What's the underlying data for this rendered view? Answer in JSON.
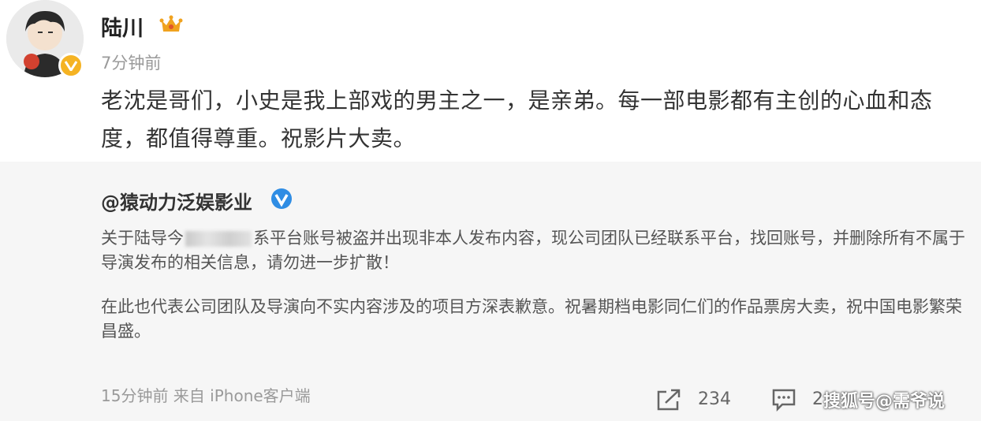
{
  "post": {
    "username": "陆川",
    "time": "7分钟前",
    "text": "老沈是哥们，小史是我上部戏的男主之一，是亲弟。每一部电影都有主创的心血和态度，都值得尊重。祝影片大卖。"
  },
  "repost": {
    "author": "@猿动力泛娱影业",
    "paragraph1_before": "关于陆导今",
    "paragraph1_after": "系平台账号被盗并出现非本人发布内容，现公司团队已经联系平台，找回账号，并删除所有不属于导演发布的相关信息，请勿进一步扩散！",
    "paragraph2": "在此也代表公司团队及导演向不实内容涉及的项目方深表歉意。祝暑期档电影同仁们的作品票房大卖，祝中国电影繁荣昌盛。",
    "meta": "15分钟前  来自 iPhone客户端",
    "share_count": "234",
    "comment_count": "2"
  },
  "watermark": "搜狐号@需爷说",
  "icons": {
    "avatar": "avatar-image",
    "verified_badge": "verified-badge-icon",
    "crown": "crown-icon",
    "repost_verified": "verified-icon",
    "share": "share-icon",
    "comment": "comment-icon"
  },
  "colors": {
    "gold": "#f5b323",
    "blue_verified": "#2f8de4",
    "repost_bg": "#f6f6f6"
  }
}
